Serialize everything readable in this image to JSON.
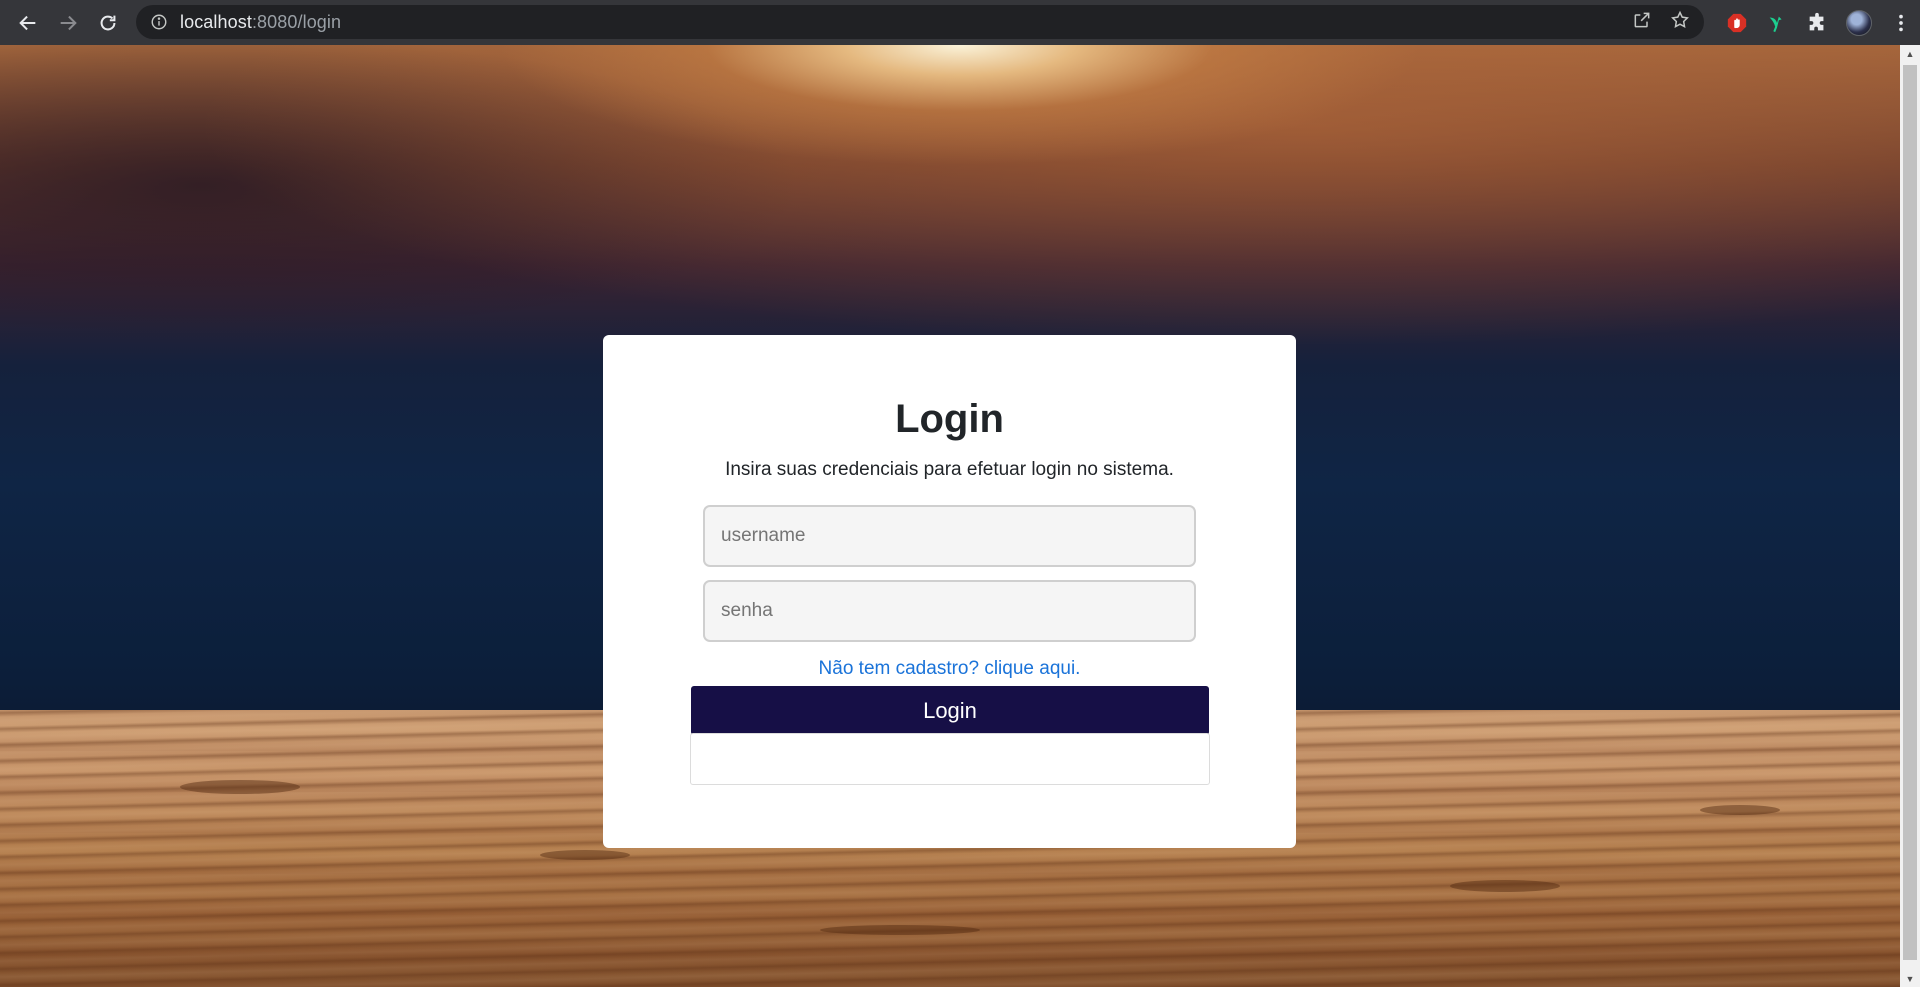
{
  "browser": {
    "url_host": "localhost",
    "url_path": ":8080/login",
    "icons": {
      "back": "back-arrow-icon",
      "forward": "forward-arrow-icon",
      "reload": "reload-icon",
      "site_info": "info-icon",
      "share": "share-icon",
      "bookmark": "star-icon",
      "ext1": "adblock-hand-icon",
      "ext2": "green-bird-icon",
      "extensions": "puzzle-icon",
      "menu": "vertical-dots-icon"
    }
  },
  "login": {
    "title": "Login",
    "subtitle": "Insira suas credenciais para efetuar login no sistema.",
    "username_placeholder": "username",
    "username_value": "",
    "password_placeholder": "senha",
    "password_value": "",
    "signup_link": "Não tem cadastro? clique aqui.",
    "submit_label": "Login",
    "message": ""
  },
  "colors": {
    "button_bg": "#160f46",
    "link": "#1a73d9",
    "card_bg": "#ffffff"
  }
}
